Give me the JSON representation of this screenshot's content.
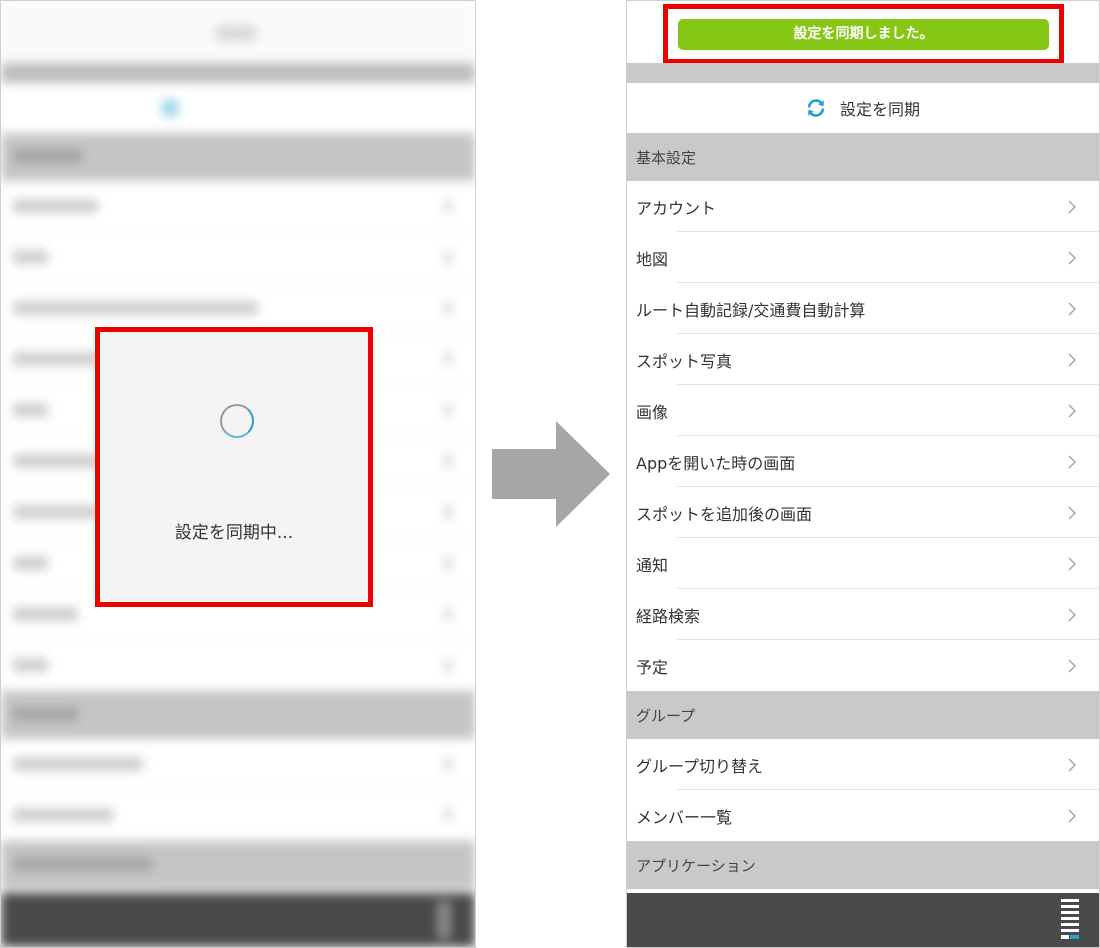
{
  "left_panel": {
    "loading_text": "設定を同期中..."
  },
  "right_panel": {
    "toast_message": "設定を同期しました。",
    "sync_label": "設定を同期",
    "sections": [
      {
        "title": "基本設定",
        "items": [
          "アカウント",
          "地図",
          "ルート自動記録/交通費自動計算",
          "スポット写真",
          "画像",
          "Appを開いた時の画面",
          "スポットを追加後の画面",
          "通知",
          "経路検索",
          "予定"
        ]
      },
      {
        "title": "グループ",
        "items": [
          "グループ切り替え",
          "メンバー一覧"
        ]
      },
      {
        "title": "アプリケーション",
        "items": []
      }
    ]
  },
  "colors": {
    "highlight": "#ee0000",
    "toast_bg": "#86c716",
    "sync_icon": "#2a9fd0",
    "section_bg": "#c9c9c9",
    "footer_bg": "#4a4a4a"
  },
  "icons": [
    "spinner-icon",
    "arrow-right-icon",
    "sync-icon",
    "chevron-right-icon",
    "grip-icon"
  ]
}
